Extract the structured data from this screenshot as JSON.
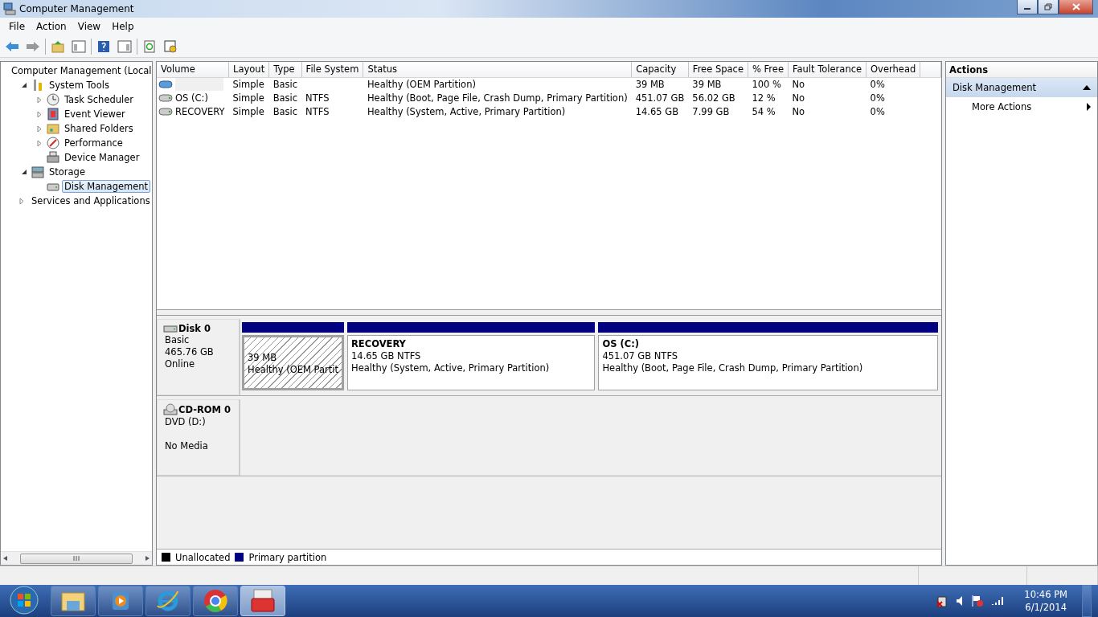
{
  "window": {
    "title": "Computer Management"
  },
  "menu": [
    "File",
    "Action",
    "View",
    "Help"
  ],
  "tree": [
    {
      "label": "Computer Management (Local",
      "kind": "computer",
      "selected": false,
      "children": [
        {
          "label": "System Tools",
          "kind": "tools",
          "expanded": true,
          "selected": false,
          "children": [
            {
              "label": "Task Scheduler",
              "kind": "clock",
              "expanded": false,
              "selected": false
            },
            {
              "label": "Event Viewer",
              "kind": "log",
              "expanded": false,
              "selected": false
            },
            {
              "label": "Shared Folders",
              "kind": "folder",
              "expanded": false,
              "selected": false
            },
            {
              "label": "Performance",
              "kind": "gauge",
              "expanded": false,
              "selected": false
            },
            {
              "label": "Device Manager",
              "kind": "device",
              "selected": false
            }
          ]
        },
        {
          "label": "Storage",
          "kind": "storage",
          "expanded": true,
          "selected": false,
          "children": [
            {
              "label": "Disk Management",
              "kind": "disk",
              "selected": true
            }
          ]
        },
        {
          "label": "Services and Applications",
          "kind": "services",
          "expanded": false,
          "selected": false
        }
      ]
    }
  ],
  "table": {
    "columns": [
      "Volume",
      "Layout",
      "Type",
      "File System",
      "Status",
      "Capacity",
      "Free Space",
      "% Free",
      "Fault Tolerance",
      "Overhead"
    ],
    "rows": [
      {
        "kind": "oem",
        "layout": "Simple",
        "type": "Basic",
        "status": "Healthy (OEM Partition)",
        "capacity": "39 MB",
        "free_space": "39 MB",
        "percent_free": "100 %",
        "fault_tolerance": "No",
        "overhead": "0%"
      },
      {
        "kind": "drive",
        "volume": "OS (C:)",
        "layout": "Simple",
        "type": "Basic",
        "file_system": "NTFS",
        "status": "Healthy (Boot, Page File, Crash Dump, Primary Partition)",
        "capacity": "451.07 GB",
        "free_space": "56.02 GB",
        "percent_free": "12 %",
        "fault_tolerance": "No",
        "overhead": "0%"
      },
      {
        "kind": "drive",
        "volume": "RECOVERY",
        "layout": "Simple",
        "type": "Basic",
        "file_system": "NTFS",
        "status": "Healthy (System, Active, Primary Partition)",
        "capacity": "14.65 GB",
        "free_space": "7.99 GB",
        "percent_free": "54 %",
        "fault_tolerance": "No",
        "overhead": "0%"
      }
    ]
  },
  "disks": [
    {
      "kind": "disk",
      "name": "Disk 0",
      "lines": [
        "Basic",
        "465.76 GB",
        "Online"
      ],
      "partitions": [
        {
          "size": "39 MB",
          "status": "Healthy (OEM Partit",
          "selected": true
        },
        {
          "title": "RECOVERY",
          "size": "14.65 GB NTFS",
          "status": "Healthy (System, Active, Primary Partition)",
          "selected": false
        },
        {
          "title": "OS  (C:)",
          "size": "451.07 GB NTFS",
          "status": "Healthy (Boot, Page File, Crash Dump, Primary Partition)",
          "selected": false
        }
      ]
    },
    {
      "kind": "cdrom",
      "name": "CD-ROM 0",
      "lines": [
        "DVD (D:)",
        "No Media"
      ]
    }
  ],
  "legend": [
    {
      "label": "Unallocated",
      "color": "#000000"
    },
    {
      "label": "Primary partition",
      "color": "#000080"
    }
  ],
  "actions": {
    "title": "Actions",
    "section": {
      "label": "Disk Management",
      "expanded": true
    },
    "items": [
      "More Actions"
    ]
  },
  "taskbar": {
    "apps": [
      {
        "kind": "explorer",
        "selected": false
      },
      {
        "kind": "media",
        "selected": false
      },
      {
        "kind": "ie",
        "selected": false
      },
      {
        "kind": "chrome",
        "selected": false
      },
      {
        "kind": "toolbox",
        "selected": true
      }
    ],
    "clock": {
      "time": "10:46 PM",
      "date": "6/1/2014"
    }
  }
}
